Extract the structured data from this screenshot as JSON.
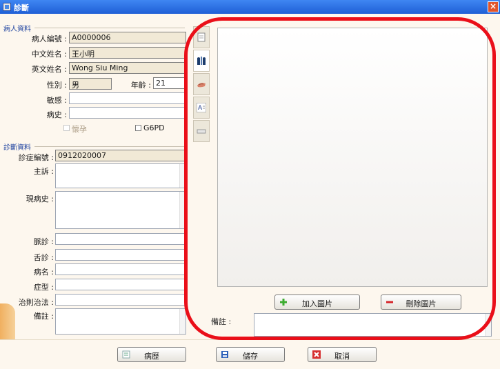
{
  "window": {
    "title": "診斷",
    "close_glyph": "×"
  },
  "patient": {
    "group_title": "病人資料",
    "id_label": "病人編號 :",
    "id_value": "A0000006",
    "cname_label": "中文姓名 :",
    "cname_value": "王小明",
    "ename_label": "英文姓名 :",
    "ename_value": "Wong Siu Ming",
    "sex_label": "性別 :",
    "sex_value": "男",
    "age_label": "年齡 :",
    "age_value": "21",
    "allergy_label": "敏感 :",
    "allergy_value": "",
    "history_label": "病史 :",
    "history_value": "",
    "pregnant_label": "懷孕",
    "g6pd_label": "G6PD"
  },
  "diagnosis": {
    "group_title": "診斷資料",
    "no_label": "診症編號 :",
    "no_value": "0912020007",
    "complaint_label": "主訴 :",
    "present_label": "現病史 :",
    "pulse_label": "脈診 :",
    "tongue_label": "舌診 :",
    "disease_label": "病名 :",
    "syndrome_label": "症型 :",
    "treatment_label": "治則治法 :",
    "remark_label": "備註 :"
  },
  "image_panel": {
    "add_button": "加入圖片",
    "delete_button": "刪除圖片",
    "remark_label": "備註 :"
  },
  "tabs": [
    {
      "icon": "document-icon"
    },
    {
      "icon": "chest-xray-icon"
    },
    {
      "icon": "hand-icon"
    },
    {
      "icon": "text-icon"
    },
    {
      "icon": "keyboard-icon"
    }
  ],
  "footer": {
    "history_button": "病歷",
    "save_button": "儲存",
    "cancel_button": "取消"
  },
  "colors": {
    "titlebar": "#2a6ee6",
    "highlight_ring": "#ea0f19",
    "panel_bg": "#fdf7ee"
  }
}
